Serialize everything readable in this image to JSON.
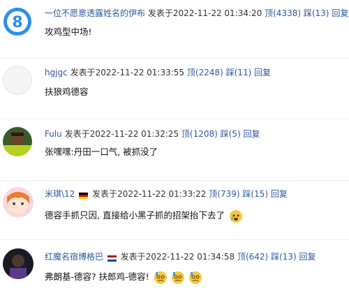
{
  "comments": [
    {
      "user": "一位不愿意透露姓名的伊布",
      "posted": "发表于2022-11-22 01:34:20",
      "ding": "顶(4338)",
      "cai": "踩(13)",
      "reply": "回复",
      "text": "攻鸡型中场!"
    },
    {
      "user": "hgjgc",
      "posted": "发表于2022-11-22 01:33:55",
      "ding": "顶(2248)",
      "cai": "踩(11)",
      "reply": "回复",
      "text": "扶狼鸡德容"
    },
    {
      "user": "Fulu",
      "posted": "发表于2022-11-22 01:32:25",
      "ding": "顶(1208)",
      "cai": "踩(5)",
      "reply": "回复",
      "text": "张嘿嘿:丹田一口气, 被抓没了"
    },
    {
      "user": "米琪\\12",
      "posted": "发表于2022-11-22 01:33:22",
      "ding": "顶(739)",
      "cai": "踩(15)",
      "reply": "回复",
      "text": "德容手抓只因, 直接给小黑子抓的招架抬下去了"
    },
    {
      "user": "红魔名宿博格巴",
      "posted": "发表于2022-11-22 01:34:58",
      "ding": "顶(642)",
      "cai": "踩(13)",
      "reply": "回复",
      "text": "弗朗基-德容? 扶郎鸡-德容!"
    }
  ],
  "colors": {
    "link": "#2c5aa0",
    "separator": "#eeeeee"
  }
}
